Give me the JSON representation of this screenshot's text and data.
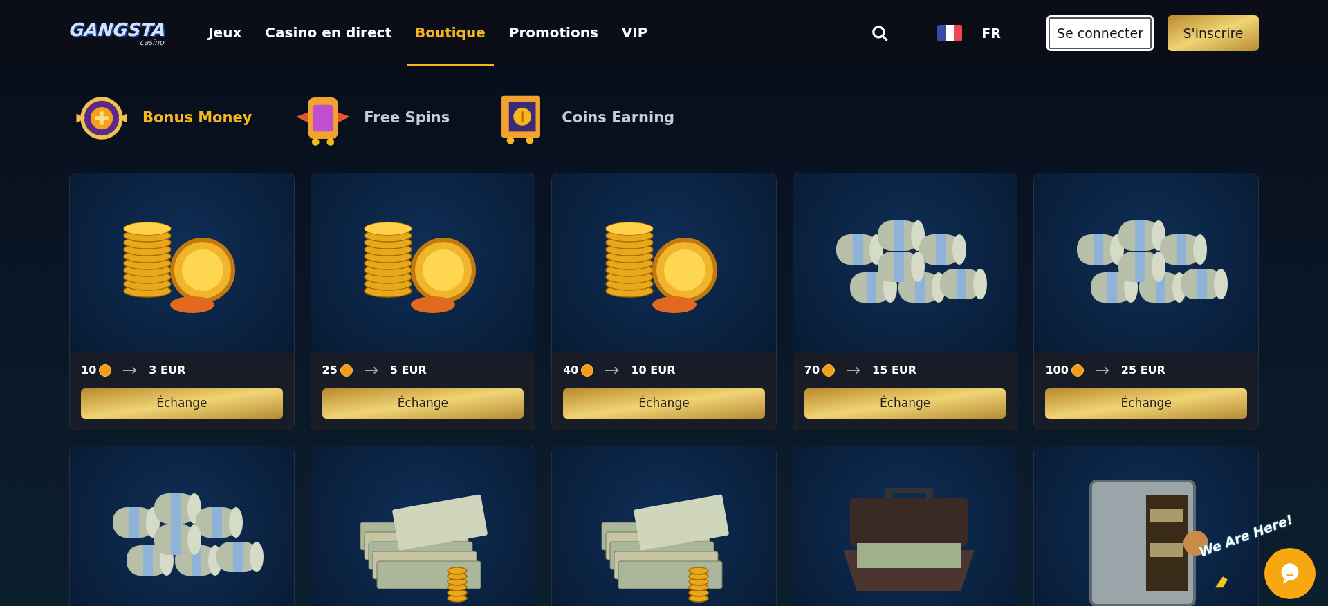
{
  "header": {
    "logo": {
      "word": "GANGSTA",
      "sub": "casino"
    },
    "nav": [
      {
        "label": "Jeux",
        "selected": false
      },
      {
        "label": "Casino en direct",
        "selected": false
      },
      {
        "label": "Boutique",
        "selected": true
      },
      {
        "label": "Promotions",
        "selected": false
      },
      {
        "label": "VIP",
        "selected": false
      }
    ],
    "language": "FR",
    "login": "Se connecter",
    "signup": "S'inscrire"
  },
  "categories": [
    {
      "label": "Bonus Money",
      "kind": "wheel",
      "selected": true
    },
    {
      "label": "Free Spins",
      "kind": "slot",
      "selected": false
    },
    {
      "label": "Coins Earning",
      "kind": "safe",
      "selected": false
    }
  ],
  "products": [
    {
      "kind": "coins",
      "coins": "10",
      "price": "3 EUR",
      "button": "Échange"
    },
    {
      "kind": "coins",
      "coins": "25",
      "price": "5 EUR",
      "button": "Échange"
    },
    {
      "kind": "coins",
      "coins": "40",
      "price": "10 EUR",
      "button": "Échange"
    },
    {
      "kind": "rolls",
      "coins": "70",
      "price": "15 EUR",
      "button": "Échange"
    },
    {
      "kind": "rolls",
      "coins": "100",
      "price": "25 EUR",
      "button": "Échange"
    },
    {
      "kind": "rolls"
    },
    {
      "kind": "bills"
    },
    {
      "kind": "bills"
    },
    {
      "kind": "briefcase"
    },
    {
      "kind": "safe"
    }
  ],
  "chat": {
    "tagline": "We Are Here!"
  }
}
